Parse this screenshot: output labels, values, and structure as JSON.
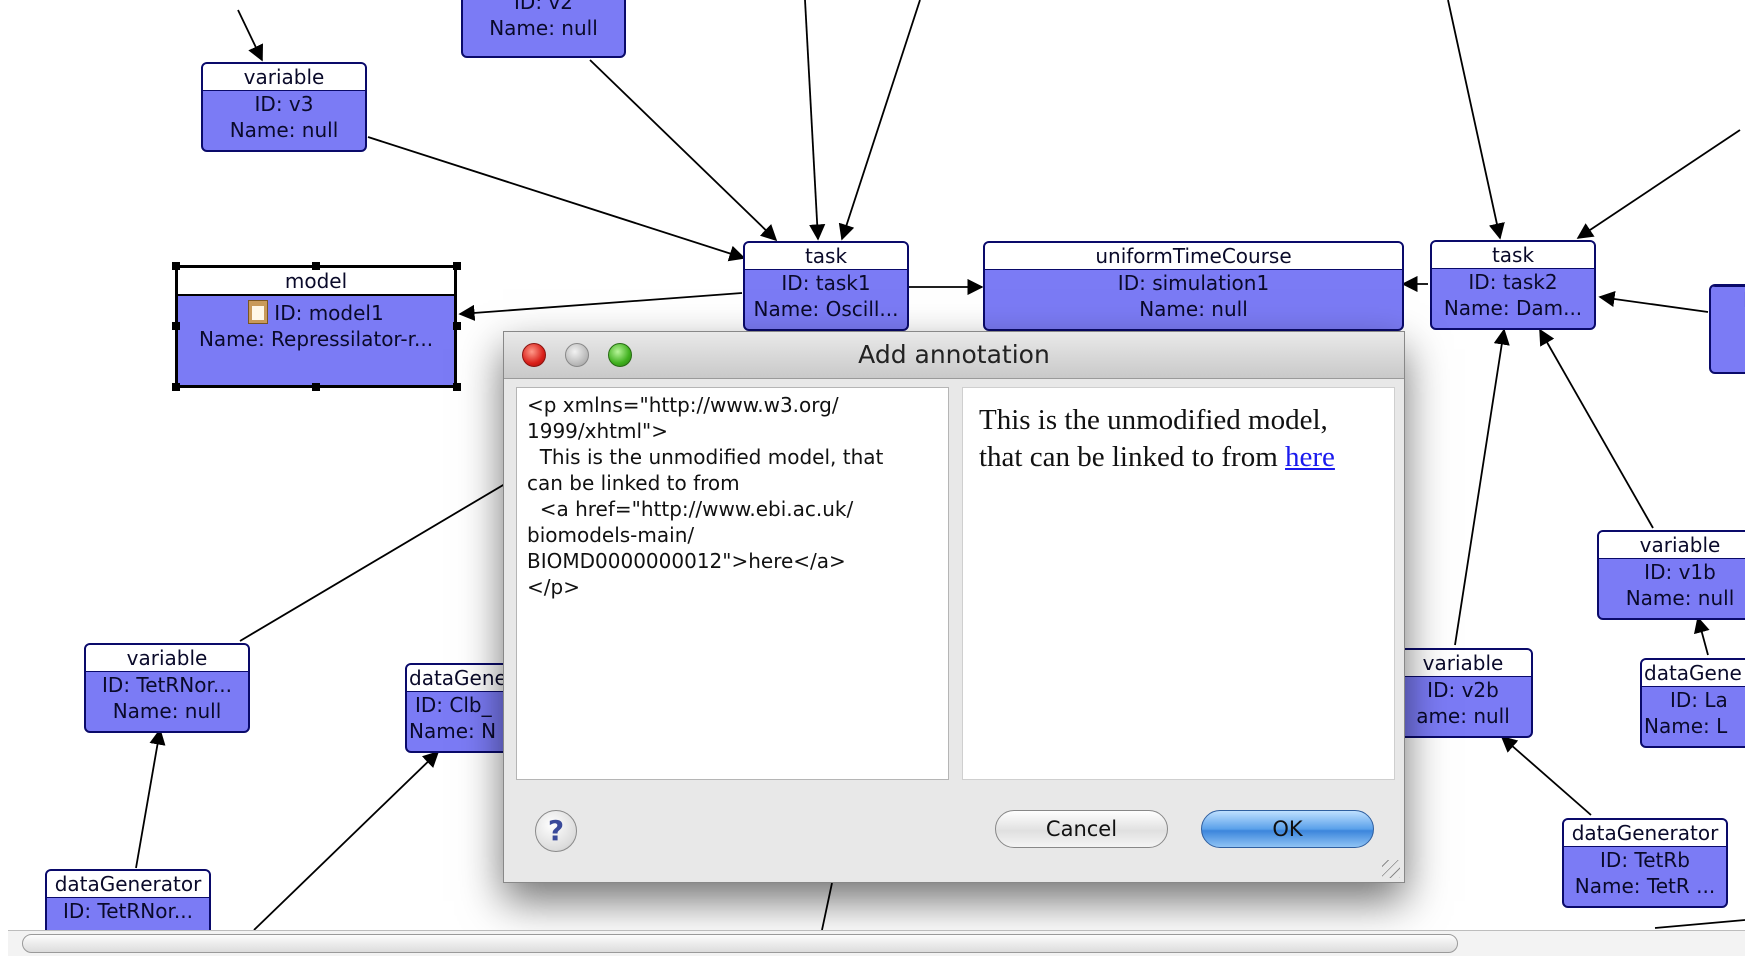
{
  "nodes": [
    {
      "kind": "",
      "id": "ID: v2",
      "name": "Name: null"
    },
    {
      "kind": "variable",
      "id": "ID: v3",
      "name": "Name: null"
    },
    {
      "kind": "model",
      "id": "ID: model1",
      "name": "Name: Repressilator-r..."
    },
    {
      "kind": "task",
      "id": "ID: task1",
      "name": "Name: Oscill..."
    },
    {
      "kind": "uniformTimeCourse",
      "id": "ID: simulation1",
      "name": "Name: null"
    },
    {
      "kind": "task",
      "id": "ID: task2",
      "name": "Name: Dam..."
    },
    {
      "kind": "variable",
      "id": "ID: v1b",
      "name": "Name: null"
    },
    {
      "kind": "variable",
      "id": "ID: v2b",
      "name": "ame: null"
    },
    {
      "kind": "variable",
      "id": "ID: TetRNor...",
      "name": "Name: null"
    },
    {
      "kind": "dataGene",
      "id": "ID: Clb_",
      "name": "Name: N"
    },
    {
      "kind": "dataGene",
      "id": "ID: La",
      "name": "Name: L"
    },
    {
      "kind": "dataGenerator",
      "id": "ID: TetRb",
      "name": "Name: TetR ..."
    },
    {
      "kind": "dataGenerator",
      "id": "ID: TetRNor...",
      "name": ""
    },
    {
      "kind": "",
      "id": "",
      "name": "N"
    }
  ],
  "dialog": {
    "title": "Add annotation",
    "source_text": "<p xmlns=\"http://www.w3.org/\n1999/xhtml\">\n  This is the unmodified model, that\ncan be linked to from\n  <a href=\"http://www.ebi.ac.uk/\nbiomodels-main/\nBIOMD0000000012\">here</a>\n</p>",
    "preview_text": "This is the unmodified model, that can be linked to from ",
    "preview_link": "here",
    "help_label": "?",
    "cancel_label": "Cancel",
    "ok_label": "OK"
  },
  "colors": {
    "node_fill": "#7b7bf5",
    "node_border": "#0a0a6a",
    "link": "#1a1aee",
    "ok_button": "#3c86dc"
  }
}
